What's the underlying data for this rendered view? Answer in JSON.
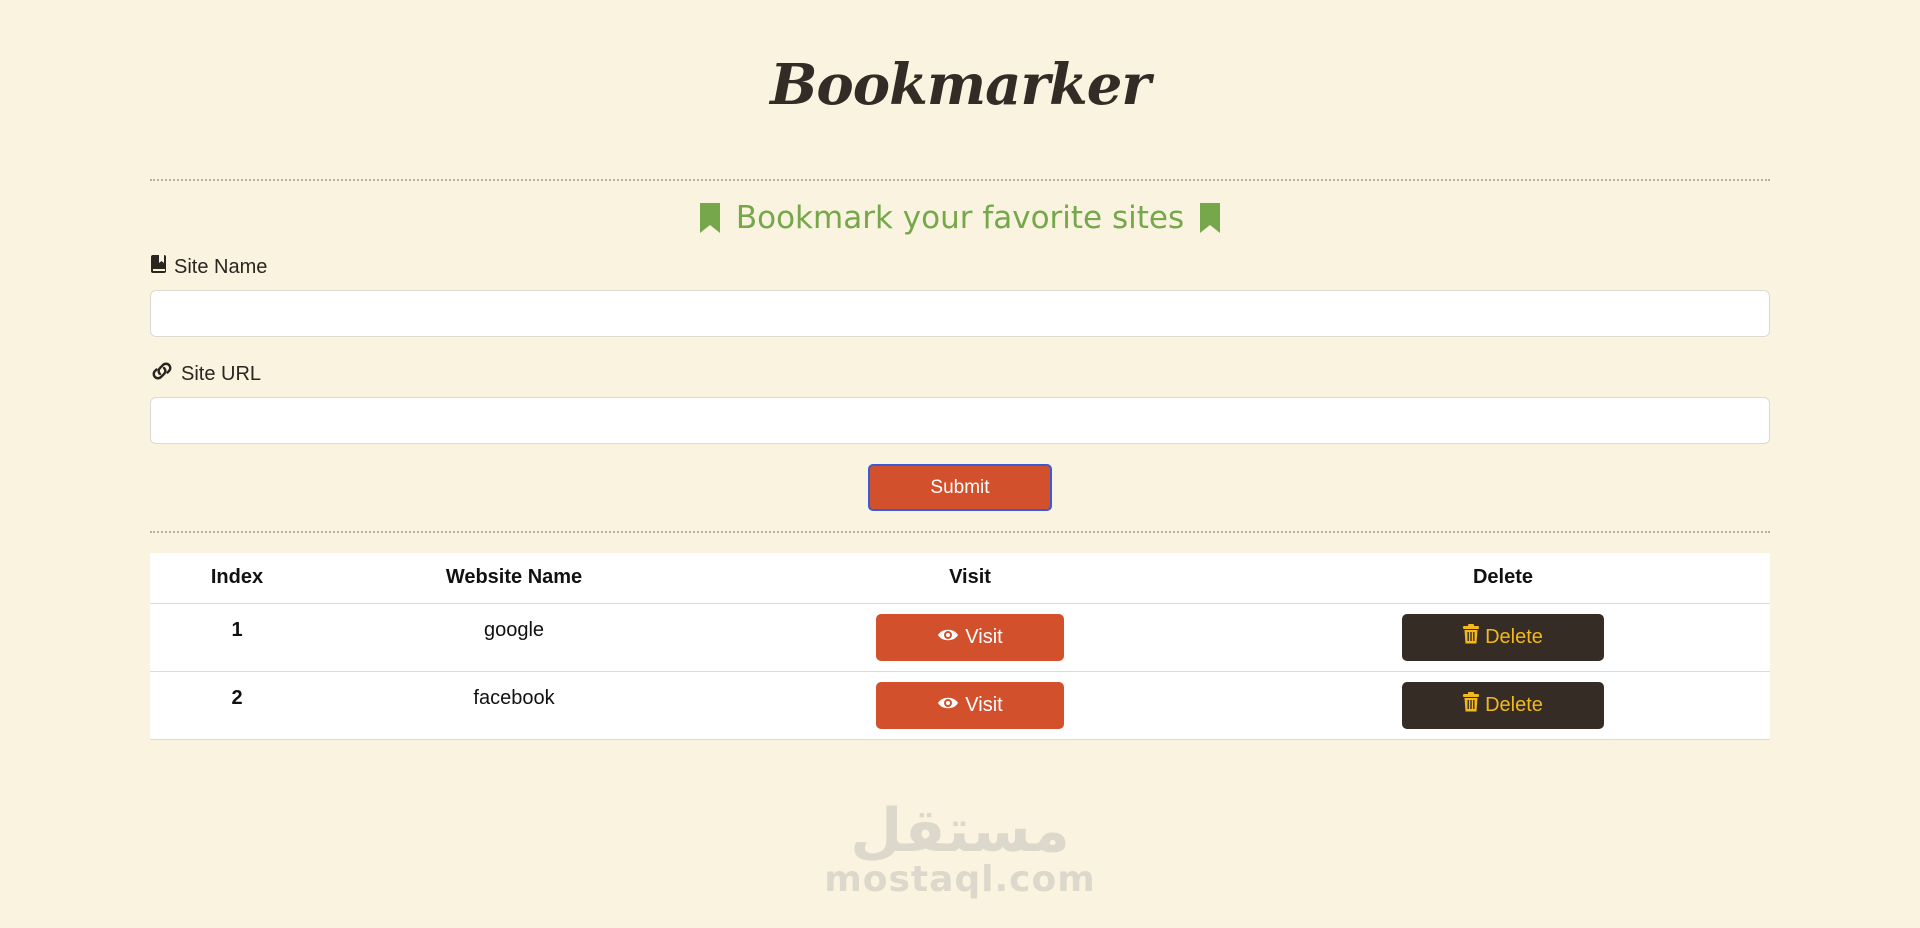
{
  "header": {
    "title": "Bookmarker"
  },
  "form": {
    "subtitle": "Bookmark your favorite sites",
    "site_name_label": "Site Name",
    "site_name_value": "",
    "site_url_label": "Site URL",
    "site_url_value": "",
    "submit_label": "Submit"
  },
  "table": {
    "columns": [
      "Index",
      "Website Name",
      "Visit",
      "Delete"
    ],
    "rows": [
      {
        "index": "1",
        "name": "google",
        "visit_label": "Visit",
        "delete_label": "Delete"
      },
      {
        "index": "2",
        "name": "facebook",
        "visit_label": "Visit",
        "delete_label": "Delete"
      }
    ]
  },
  "watermark": {
    "logo_text": "مستقل",
    "url": "mostaql.com"
  },
  "icons": {
    "subtitle_left": "bookmark-icon",
    "subtitle_right": "bookmark-icon",
    "site_name": "book-bookmark-icon",
    "site_url": "link-icon",
    "visit": "eye-icon",
    "delete": "trash-icon"
  },
  "colors": {
    "background": "#f9f3e0",
    "accent_orange": "#d2502c",
    "dark_button": "#352c25",
    "delete_text": "#f2b81c",
    "subtitle_green": "#76a84b"
  }
}
